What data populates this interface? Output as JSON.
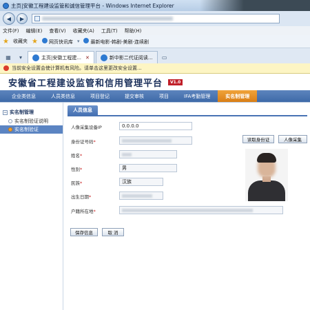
{
  "window": {
    "title": "主页|安徽工程建设监管和诚信管理平台 - Windows Internet Explorer"
  },
  "menu": [
    "文件(F)",
    "编辑(E)",
    "查看(V)",
    "收藏夹(A)",
    "工具(T)",
    "帮助(H)"
  ],
  "favorites": {
    "label": "收藏夹",
    "item1": "网页快讯库",
    "item2": "最新电影-韩剧-美剧-连续剧"
  },
  "tabs": [
    {
      "label": "主页|安徽工程建..."
    },
    {
      "label": "新中影二代证阅读..."
    }
  ],
  "security_bar": {
    "text": "当前安全设置会使计算机有风险。请单击这里更改安全设置..."
  },
  "site": {
    "title": "安徽省工程建设监管和信用管理平台",
    "version": "V1.0"
  },
  "main_nav": [
    "企业类信息",
    "人员类信息",
    "项目登记",
    "提交审核",
    "项目",
    "IFA考勤管理",
    "实名制管理"
  ],
  "sidebar": {
    "group": "实名制管理",
    "items": [
      "实名制验证说明",
      "实名制验证"
    ]
  },
  "panel": {
    "tab": "人员信息"
  },
  "form": {
    "ip_label": "人像采集设备IP",
    "ip_value": "0.0.0.0",
    "id_label": "身份证号码",
    "name_label": "姓名",
    "gender_label": "性别",
    "gender_value": "男",
    "ethnic_label": "民族",
    "ethnic_value": "汉族",
    "birth_label": "出生日期",
    "address_label": "户籍所在地",
    "read_id_button": "读取身份证",
    "capture_button": "人像采集",
    "save_button": "保存信息",
    "cancel_button": "取 消"
  },
  "colors": {
    "nav": "#4a74b0",
    "nav_active": "#e8922a",
    "title": "#1a2f5a"
  }
}
